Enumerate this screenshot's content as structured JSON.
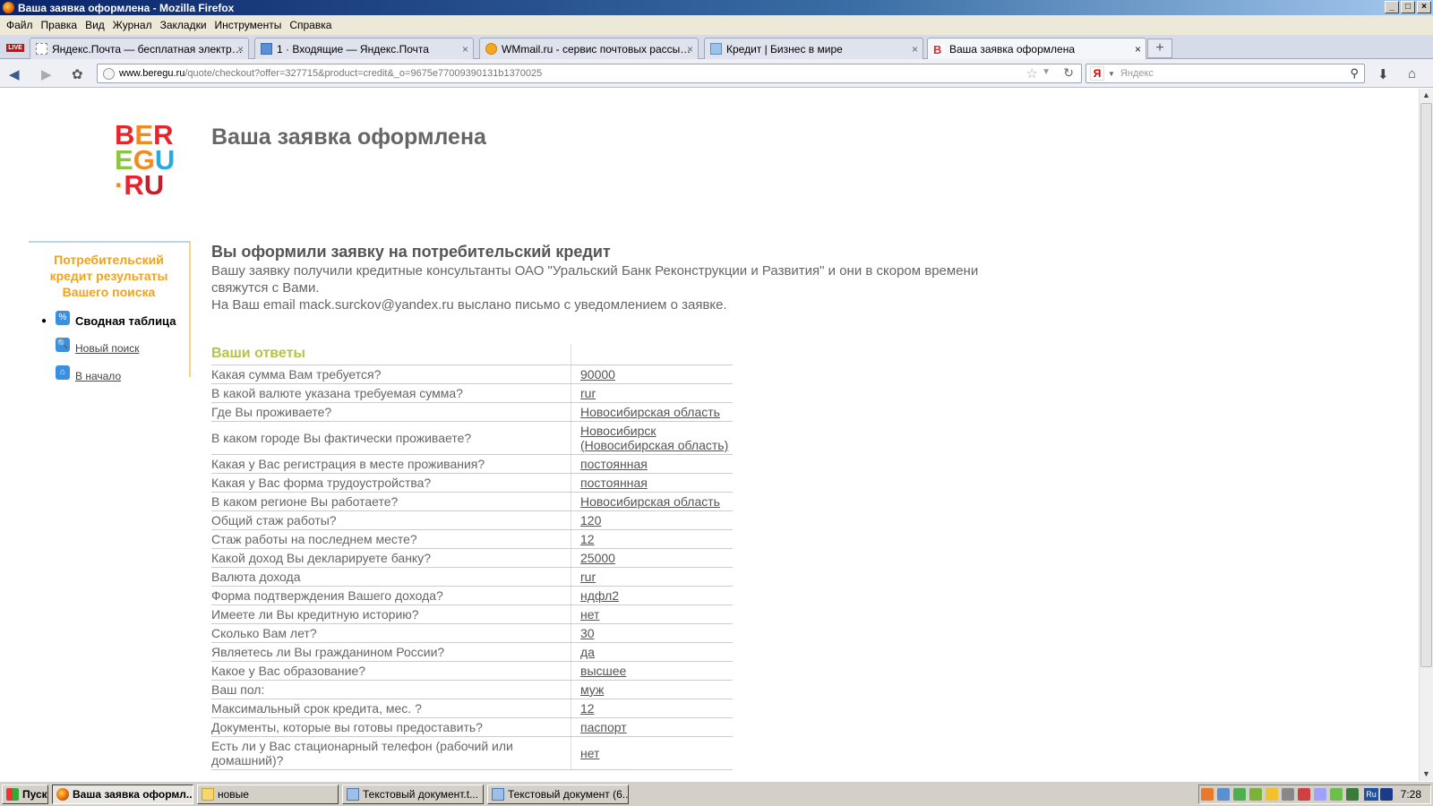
{
  "window": {
    "title": "Ваша заявка оформлена - Mozilla Firefox",
    "min": "_",
    "max": "□",
    "close": "×"
  },
  "menu": [
    "Файл",
    "Правка",
    "Вид",
    "Журнал",
    "Закладки",
    "Инструменты",
    "Справка"
  ],
  "tabs": [
    {
      "label": "Яндекс.Почта — бесплатная электрон...",
      "active": false
    },
    {
      "label": "1 · Входящие — Яндекс.Почта",
      "active": false
    },
    {
      "label": "WMmail.ru - сервис почтовых рассылок...",
      "active": false
    },
    {
      "label": "Кредит | Бизнес в мире",
      "active": false
    },
    {
      "label": "Ваша заявка оформлена",
      "active": true
    }
  ],
  "live_badge": "LIVE",
  "new_tab": "+",
  "nav": {
    "url_host": "www.beregu.ru",
    "url_path": "/quote/checkout?offer=327715&product=credit&_o=9675e77009390131b1370025",
    "search_placeholder": "Яндекс",
    "search_brand": "Я"
  },
  "page": {
    "logo": {
      "rows": [
        [
          {
            "t": "B",
            "c": "#e8232b"
          },
          {
            "t": "E",
            "c": "#f18b21"
          },
          {
            "t": "R",
            "c": "#e8232b"
          }
        ],
        [
          {
            "t": "E",
            "c": "#8cc63f"
          },
          {
            "t": "G",
            "c": "#f18b21"
          },
          {
            "t": "U",
            "c": "#27aae1"
          }
        ],
        [
          {
            "t": "·",
            "c": "#f18b21"
          },
          {
            "t": "R",
            "c": "#e8232b"
          },
          {
            "t": "U",
            "c": "#c21f2e"
          }
        ]
      ]
    },
    "title": "Ваша заявка оформлена",
    "sidebar": {
      "heading": "Потребительский кредит результаты Вашего поиска",
      "items": [
        {
          "label": "Сводная таблица",
          "icon": "%",
          "current": true
        },
        {
          "label": "Новый поиск",
          "icon": "🔍",
          "current": false
        },
        {
          "label": "В начало",
          "icon": "⌂",
          "current": false
        }
      ]
    },
    "heading2": "Вы оформили заявку на потребительский кредит",
    "paragraph1": "Вашу заявку получили кредитные консультанты ОАО \"Уральский Банк Реконструкции и Развития\" и они в скором времени свяжутся с Вами.",
    "paragraph2": "На Ваш email mack.surckov@yandex.ru выслано письмо с уведомлением о заявке.",
    "answers_title": "Ваши ответы",
    "answers": [
      {
        "q": "Какая сумма Вам требуется?",
        "a": "90000"
      },
      {
        "q": "В какой валюте указана требуемая сумма?",
        "a": "rur"
      },
      {
        "q": "Где Вы проживаете?",
        "a": "Новосибирская область"
      },
      {
        "q": "В каком городе Вы фактически проживаете?",
        "a": "Новосибирск (Новосибирская область)"
      },
      {
        "q": "Какая у Вас регистрация в месте проживания?",
        "a": "постоянная"
      },
      {
        "q": "Какая у Вас форма трудоустройства?",
        "a": "постоянная"
      },
      {
        "q": "В каком регионе Вы работаете?",
        "a": "Новосибирская область"
      },
      {
        "q": "Общий стаж работы?",
        "a": "120"
      },
      {
        "q": "Стаж работы на последнем месте?",
        "a": "12"
      },
      {
        "q": "Какой доход Вы декларируете банку?",
        "a": "25000"
      },
      {
        "q": "Валюта дохода",
        "a": "rur"
      },
      {
        "q": "Форма подтверждения Вашего дохода?",
        "a": "ндфл2"
      },
      {
        "q": "Имеете ли Вы кредитную историю?",
        "a": "нет"
      },
      {
        "q": "Сколько Вам лет?",
        "a": "30"
      },
      {
        "q": "Являетесь ли Вы гражданином России?",
        "a": "да"
      },
      {
        "q": "Какое у Вас образование?",
        "a": "высшее"
      },
      {
        "q": "Ваш пол:",
        "a": "муж"
      },
      {
        "q": "Максимальный срок кредита, мес. ?",
        "a": "12"
      },
      {
        "q": "Документы, которые вы готовы предоставить?",
        "a": "паспорт"
      },
      {
        "q": "Есть ли у Вас стационарный телефон (рабочий или домашний)?",
        "a": "нет"
      }
    ]
  },
  "taskbar": {
    "start": "Пуск",
    "tasks": [
      {
        "label": "Ваша заявка оформл...",
        "active": true
      },
      {
        "label": "новые",
        "active": false
      },
      {
        "label": "Текстовый документ.t...",
        "active": false
      },
      {
        "label": "Текстовый документ (6...",
        "active": false
      }
    ],
    "lang": "Ru",
    "clock": "7:28"
  }
}
